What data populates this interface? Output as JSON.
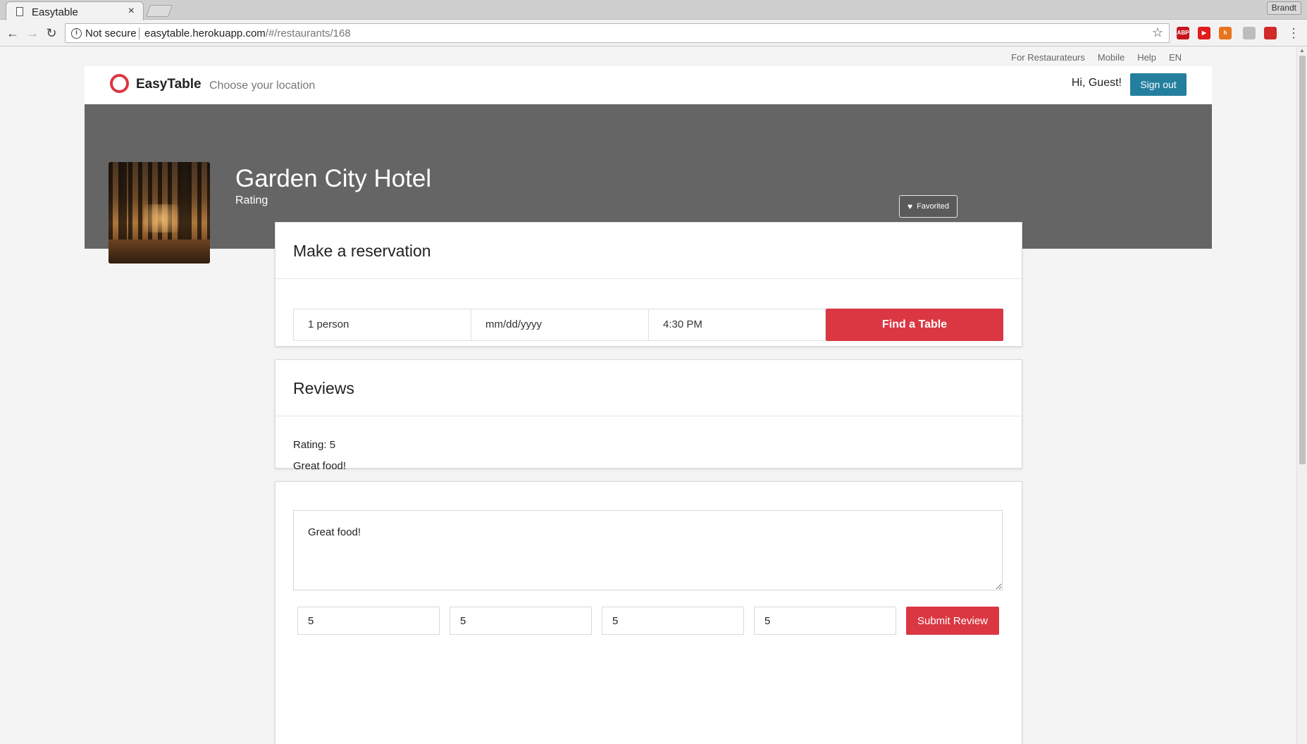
{
  "browser": {
    "tab_title": "Easytable",
    "tab_close": "×",
    "profile_name": "Brandt",
    "security_label": "Not secure",
    "url_host": "easytable.herokuapp.com",
    "url_path": "/#/restaurants/168",
    "extensions": [
      {
        "name": "adblock-plus-icon",
        "text": "ABP",
        "color": "#c8161d"
      },
      {
        "name": "youtube-icon",
        "text": "▶",
        "color": "#e21b1b"
      },
      {
        "name": "feed-icon",
        "text": "h",
        "color": "#e8741d"
      },
      {
        "name": "extension-gray-icon",
        "text": "",
        "color": "#bdbdbd"
      },
      {
        "name": "extension-red-icon",
        "text": "",
        "color": "#d02a2a"
      }
    ]
  },
  "site": {
    "top_links": [
      "For Restaurateurs",
      "Mobile",
      "Help",
      "EN"
    ],
    "brand": "EasyTable",
    "location_prompt": "Choose your location",
    "greeting": "Hi, Guest!",
    "sign_out": "Sign out",
    "accent_color": "#da3743",
    "signout_color": "#247f9e"
  },
  "restaurant": {
    "name": "Garden City Hotel",
    "rating_label": "Rating",
    "favorite_label": "Favorited"
  },
  "reservation": {
    "title": "Make a reservation",
    "party_size": "1 person",
    "date_placeholder": "mm/dd/yyyy",
    "time": "4:30 PM",
    "find_button": "Find a Table"
  },
  "reviews": {
    "title": "Reviews",
    "items": [
      {
        "rating": "Rating: 5",
        "body": "Great food!"
      }
    ]
  },
  "review_form": {
    "text": "Great food!",
    "scores": [
      "5",
      "5",
      "5",
      "5"
    ],
    "submit_label": "Submit Review"
  }
}
